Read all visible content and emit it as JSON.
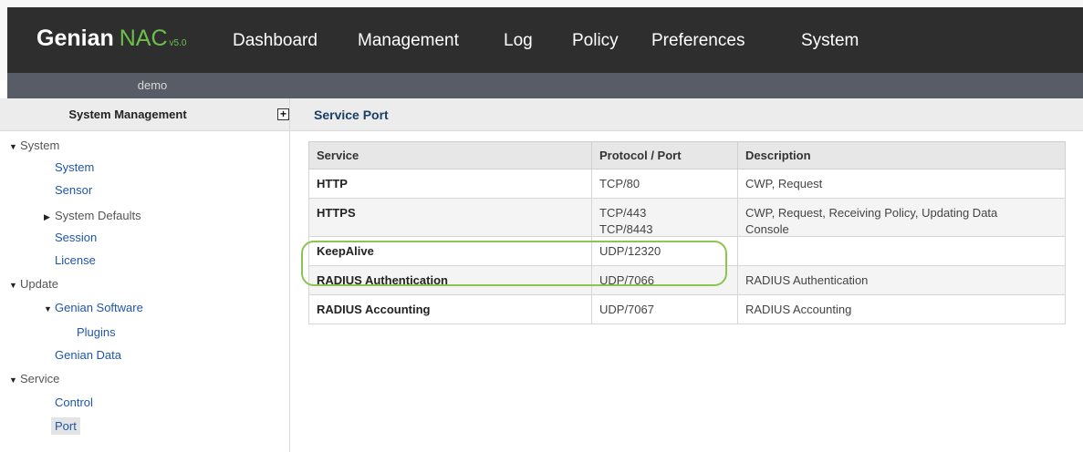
{
  "app": {
    "logo_main": "Genian",
    "logo_product": "NAC",
    "logo_version": "v5.0"
  },
  "nav": {
    "items": [
      "Dashboard",
      "Management",
      "Log",
      "Policy",
      "Preferences",
      "System"
    ]
  },
  "user": "demo",
  "sidebar": {
    "title": "System Management",
    "expand_icon": "plus-icon",
    "items": [
      {
        "label": "System"
      },
      {
        "label": "System"
      },
      {
        "label": "Sensor"
      },
      {
        "label": "System Defaults"
      },
      {
        "label": "Session"
      },
      {
        "label": "License"
      },
      {
        "label": "Update"
      },
      {
        "label": "Genian Software"
      },
      {
        "label": "Plugins"
      },
      {
        "label": "Genian Data"
      },
      {
        "label": "Service"
      },
      {
        "label": "Control"
      },
      {
        "label": "Port"
      }
    ]
  },
  "main": {
    "title": "Service Port",
    "table": {
      "headers": [
        "Service",
        "Protocol / Port",
        "Description"
      ],
      "rows": [
        {
          "service": "HTTP",
          "port1": "TCP/80",
          "port2": "",
          "desc1": "CWP, Request",
          "desc2": ""
        },
        {
          "service": "HTTPS",
          "port1": "TCP/443",
          "port2": "TCP/8443",
          "desc1": "CWP, Request, Receiving Policy, Updating Data",
          "desc2": "Console"
        },
        {
          "service": "KeepAlive",
          "port1": "UDP/12320",
          "port2": "",
          "desc1": "",
          "desc2": ""
        },
        {
          "service": "RADIUS Authentication",
          "port1": "UDP/7066",
          "port2": "",
          "desc1": "RADIUS Authentication",
          "desc2": ""
        },
        {
          "service": "RADIUS Accounting",
          "port1": "UDP/7067",
          "port2": "",
          "desc1": "RADIUS Accounting",
          "desc2": ""
        }
      ]
    }
  },
  "colors": {
    "header_dark": "#2e2e2e",
    "subbar": "#575c66",
    "brand_green": "#6cc04a",
    "link_blue": "#1f56a8",
    "highlight": "#8dc44f"
  }
}
